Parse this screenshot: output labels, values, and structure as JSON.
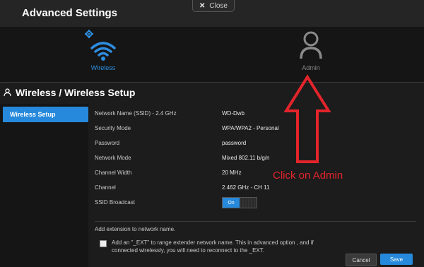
{
  "header": {
    "title": "Advanced Settings",
    "close_label": "Close"
  },
  "nav": {
    "wireless_label": "Wireless",
    "admin_label": "Admin"
  },
  "section": {
    "title": "Wireless / Wireless Setup"
  },
  "sidebar": {
    "items": [
      {
        "label": "Wireless Setup"
      }
    ]
  },
  "settings": [
    {
      "label": "Network Name (SSID) - 2.4 GHz",
      "value": "WD-Dwb"
    },
    {
      "label": "Security Mode",
      "value": "WPA/WPA2 - Personal"
    },
    {
      "label": "Password",
      "value": "password"
    },
    {
      "label": "Network Mode",
      "value": "Mixed 802.11 b/g/n"
    },
    {
      "label": "Channel Width",
      "value": "20 MHz"
    },
    {
      "label": "Channel",
      "value": "2.462 GHz - CH 11"
    },
    {
      "label": "SSID Broadcast",
      "value": ""
    }
  ],
  "ssid_broadcast": {
    "state": "On"
  },
  "extender": {
    "title": "Add extension to network name.",
    "checkbox_text": "Add an \"_EXT\" to range extender network name. This in advanced option , and if connected wirelessly, you will need to reconnect to the _EXT.",
    "checked": false
  },
  "buttons": {
    "cancel": "Cancel",
    "save": "Save"
  },
  "annotation": {
    "text": "Click on Admin",
    "color": "#e3242b"
  },
  "colors": {
    "accent": "#2689dc",
    "background": "#1c1c1c"
  },
  "icons": {
    "wireless": "wifi-gear-icon",
    "admin": "user-icon",
    "section": "user-outline-icon"
  }
}
